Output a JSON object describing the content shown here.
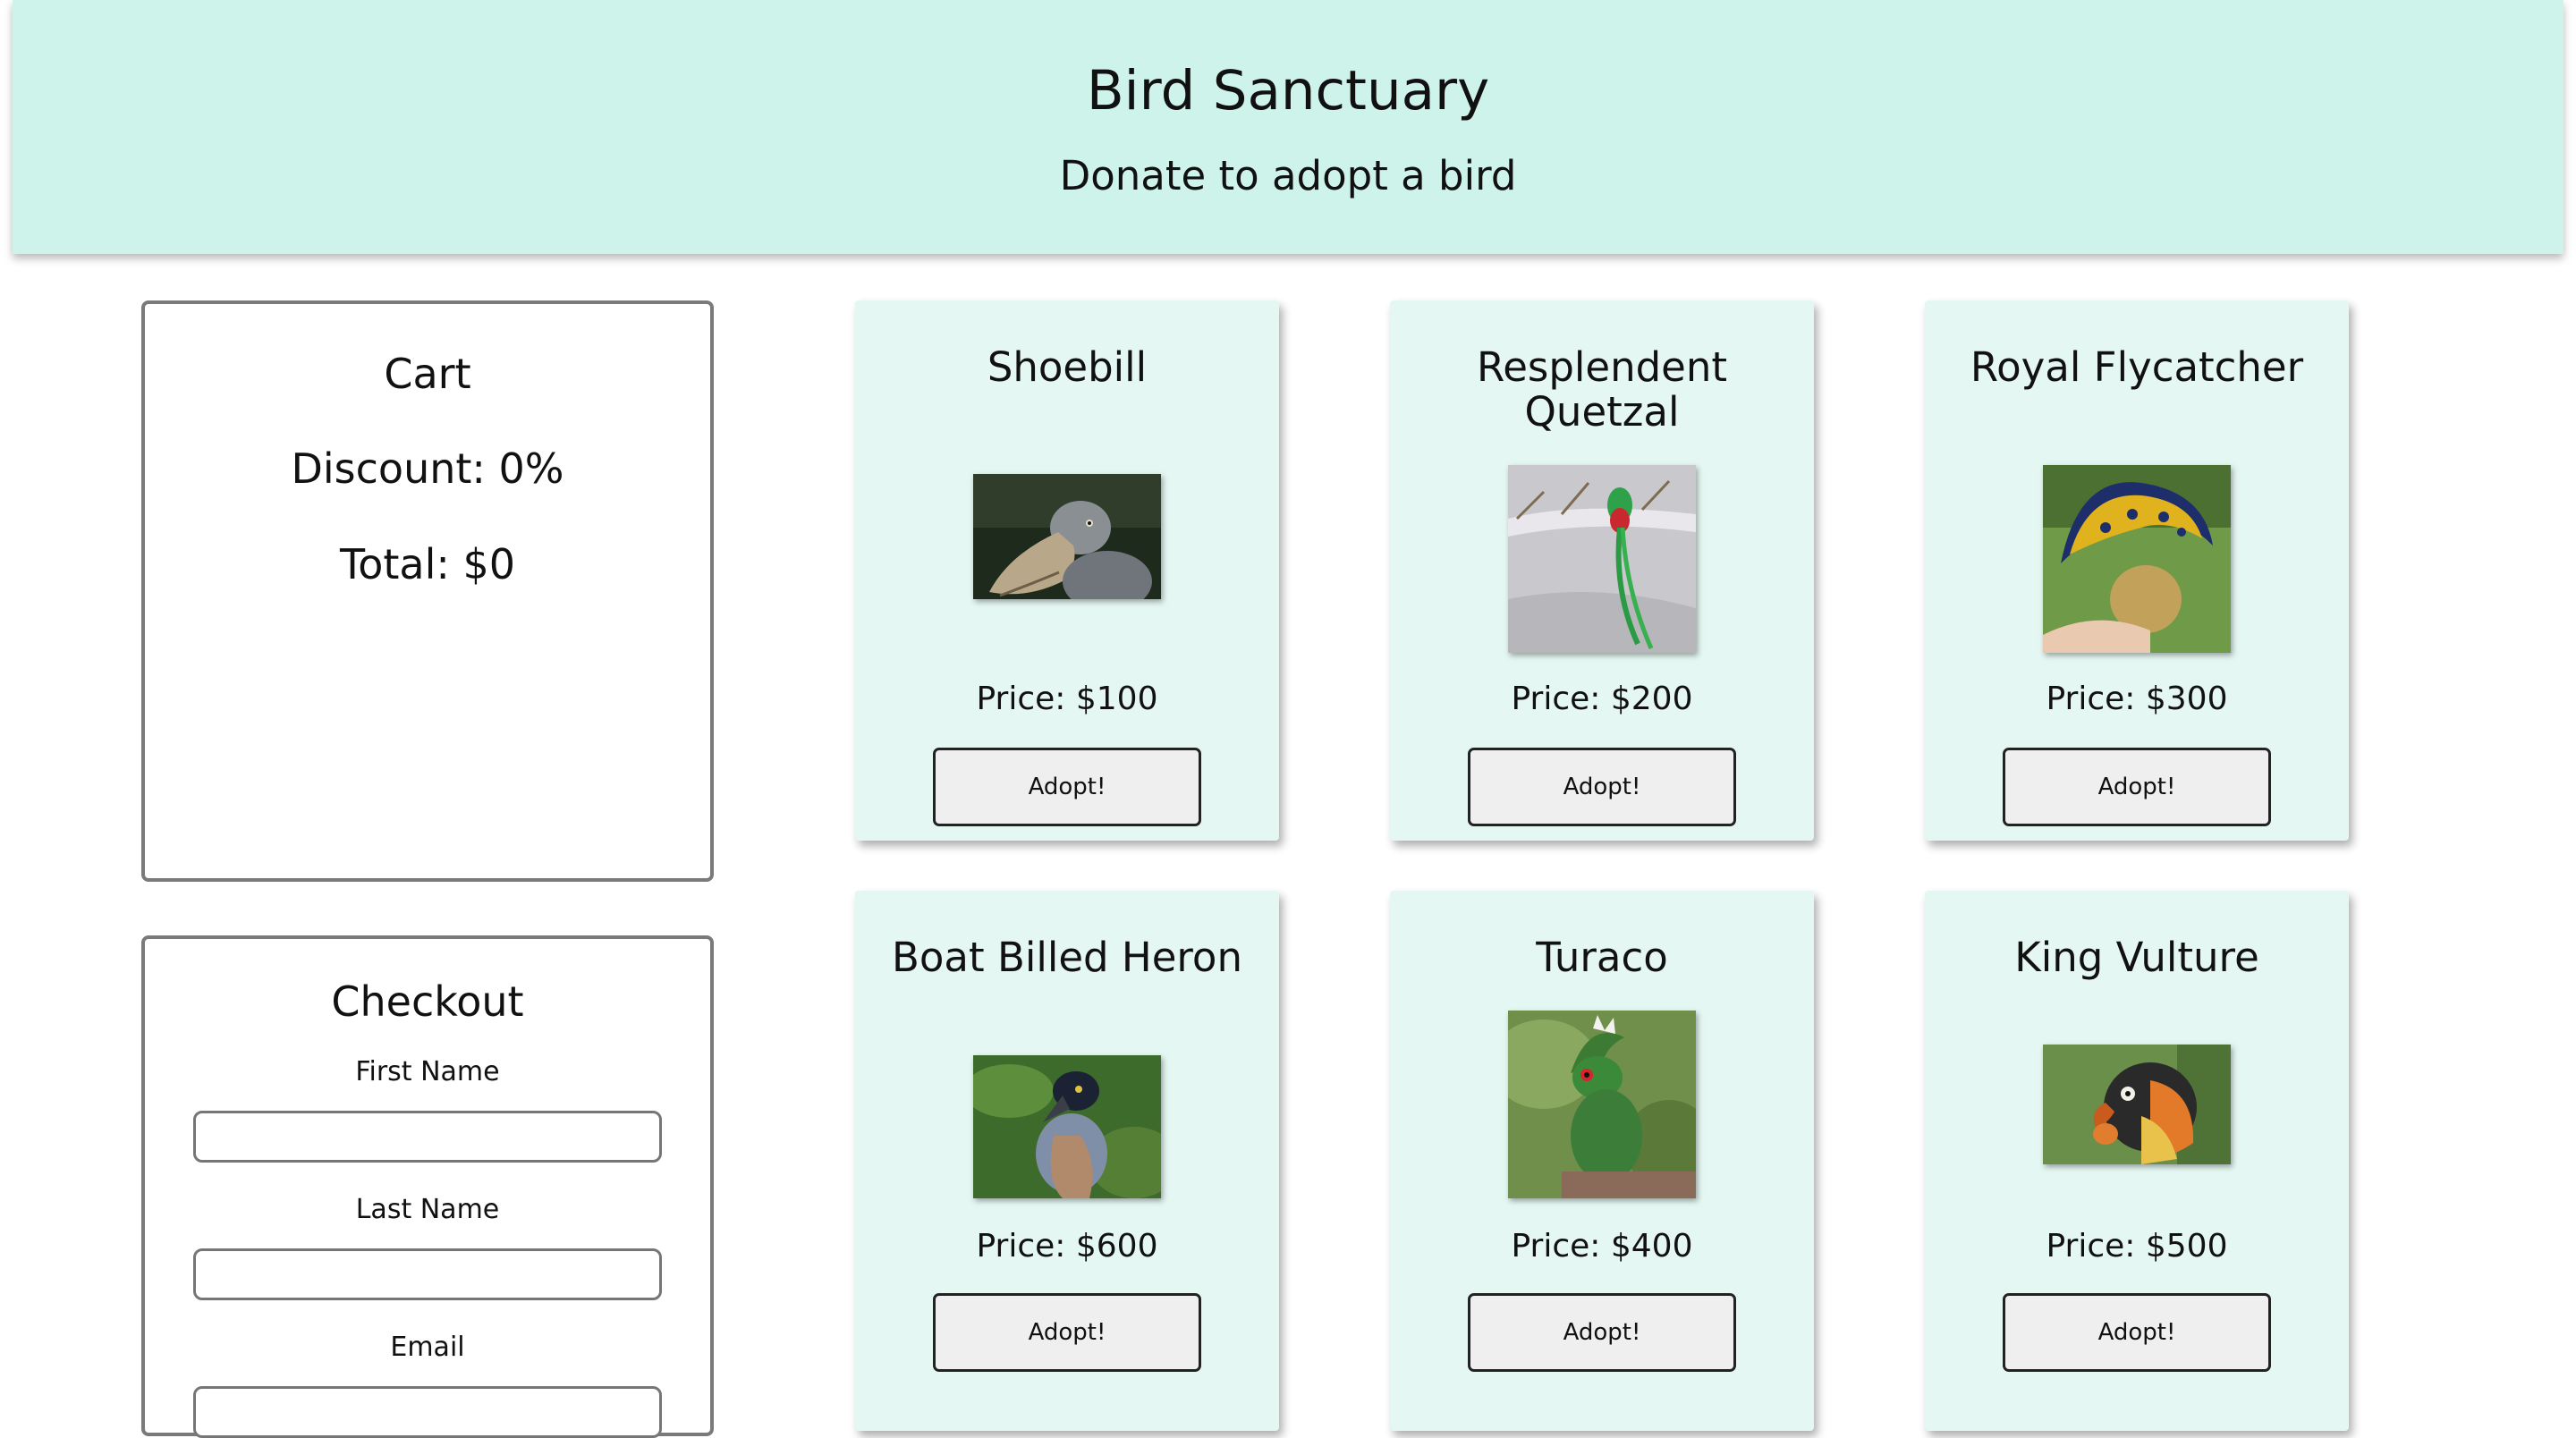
{
  "header": {
    "title": "Bird Sanctuary",
    "subtitle": "Donate to adopt a bird",
    "background": "#cef3ea"
  },
  "cart": {
    "title": "Cart",
    "discount_label": "Discount: 0%",
    "total_label": "Total: $0"
  },
  "checkout": {
    "title": "Checkout",
    "fields": [
      {
        "label": "First Name",
        "value": ""
      },
      {
        "label": "Last Name",
        "value": ""
      },
      {
        "label": "Email",
        "value": ""
      }
    ]
  },
  "birds": [
    {
      "name": "Shoebill",
      "price_label": "Price: $100",
      "button_label": "Adopt!",
      "image_icon": "shoebill-photo"
    },
    {
      "name": "Resplendent Quetzal",
      "price_label": "Price: $200",
      "button_label": "Adopt!",
      "image_icon": "quetzal-photo"
    },
    {
      "name": "Royal Flycatcher",
      "price_label": "Price: $300",
      "button_label": "Adopt!",
      "image_icon": "flycatcher-photo"
    },
    {
      "name": "Boat Billed Heron",
      "price_label": "Price: $600",
      "button_label": "Adopt!",
      "image_icon": "heron-photo"
    },
    {
      "name": "Turaco",
      "price_label": "Price: $400",
      "button_label": "Adopt!",
      "image_icon": "turaco-photo"
    },
    {
      "name": "King Vulture",
      "price_label": "Price: $500",
      "button_label": "Adopt!",
      "image_icon": "vulture-photo"
    }
  ],
  "colors": {
    "card_background": "#e5f7f2",
    "button_background": "#efefef"
  }
}
